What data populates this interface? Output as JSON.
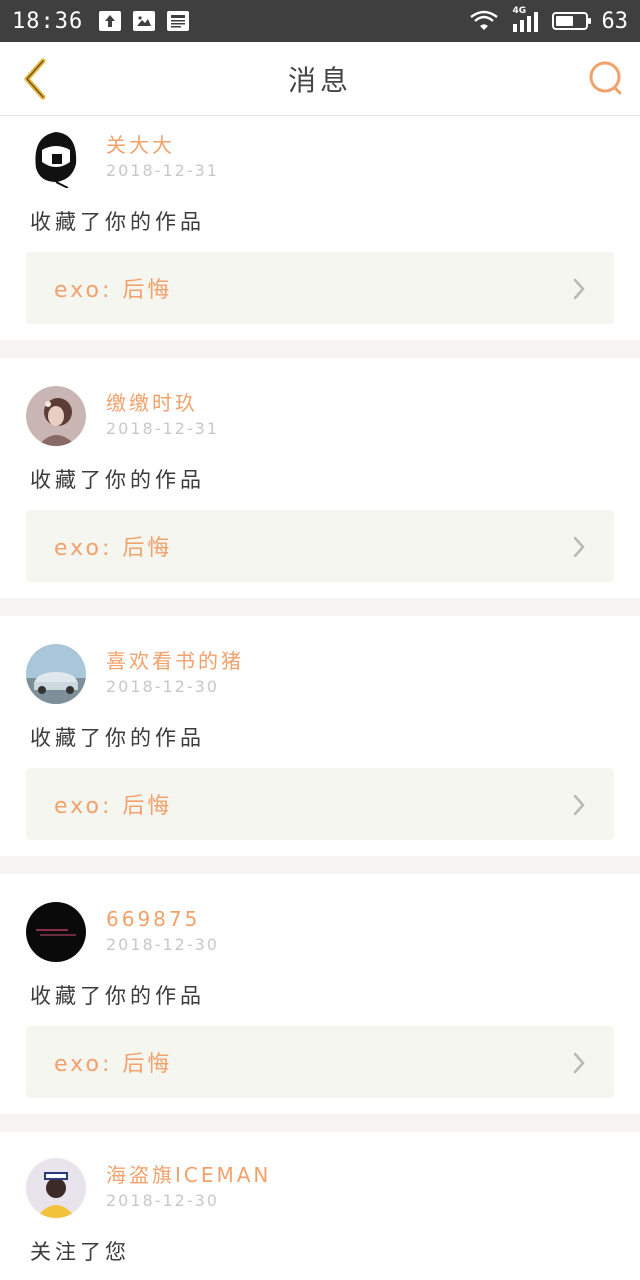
{
  "status_bar": {
    "time": "18:36",
    "network": "4G",
    "battery": "63",
    "battery_level": 0.63
  },
  "header": {
    "title": "消息",
    "back_icon": "chevron-left-icon",
    "search_icon": "search-icon"
  },
  "colors": {
    "accent": "#f2a16b",
    "back_icon": "#e2b13c",
    "work_box_bg": "#f6f6f1",
    "separator": "#f6f5f4"
  },
  "messages": [
    {
      "username": "关大大",
      "date": "2018-12-31",
      "action": "收藏了你的作品",
      "work": "exo: 后悔",
      "avatar": "cartoon-girl-avatar"
    },
    {
      "username": "缴缴时玖",
      "date": "2018-12-31",
      "action": "收藏了你的作品",
      "work": "exo: 后悔",
      "avatar": "girl-photo-avatar"
    },
    {
      "username": "喜欢看书的猪",
      "date": "2018-12-30",
      "action": "收藏了你的作品",
      "work": "exo: 后悔",
      "avatar": "car-photo-avatar"
    },
    {
      "username": "669875",
      "date": "2018-12-30",
      "action": "收藏了你的作品",
      "work": "exo: 后悔",
      "avatar": "dark-text-avatar"
    },
    {
      "username": "海盗旗ICEMAN",
      "date": "2018-12-30",
      "action": "关注了您",
      "avatar": "fila-photo-avatar"
    }
  ]
}
